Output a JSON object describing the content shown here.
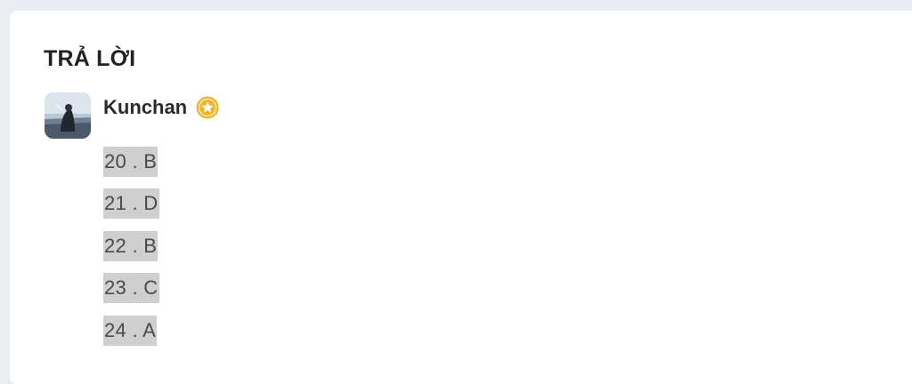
{
  "section": {
    "title": "TRẢ LỜI"
  },
  "answer": {
    "author": {
      "name": "Kunchan",
      "badge_icon": "verified-star-icon",
      "badge_color": "#f0b429"
    },
    "lines": [
      "20 . B",
      "21 . D",
      "22 . B",
      "23 . C",
      "24 . A"
    ]
  }
}
